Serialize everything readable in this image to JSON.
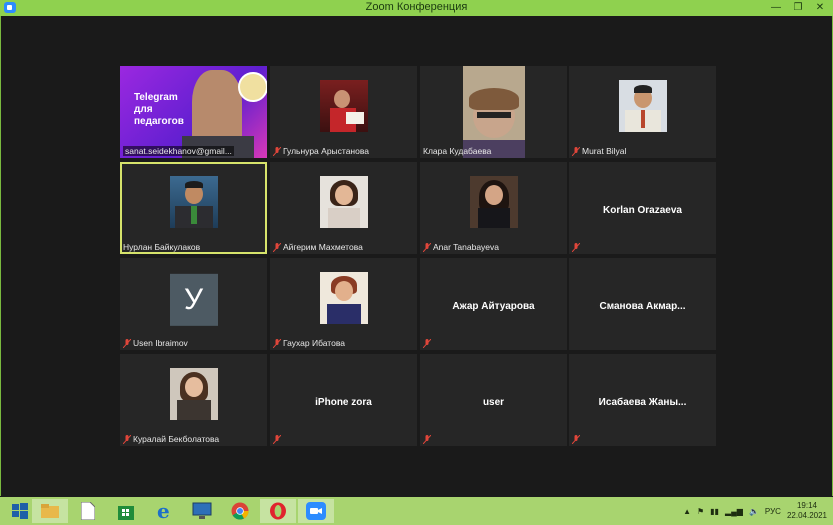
{
  "window": {
    "title": "Zoom Конференция",
    "min_glyph": "—",
    "max_glyph": "❐",
    "close_glyph": "✕"
  },
  "participants": [
    {
      "name": "sanat.seidekhanov@gmail...",
      "kind": "video-share",
      "share_text": "Telegram для педагогов",
      "muted": false
    },
    {
      "name": "Гульнура Арыстанова",
      "kind": "photo",
      "muted": true
    },
    {
      "name": "Клара Кудабаева",
      "kind": "video",
      "muted": false
    },
    {
      "name": "Murat Bilyal",
      "kind": "photo",
      "muted": true
    },
    {
      "name": "Нурлан Байкулаков",
      "kind": "photo",
      "muted": false,
      "active_speaker": true
    },
    {
      "name": "Айгерим Махметова",
      "kind": "photo",
      "muted": true
    },
    {
      "name": "Anar Tanabayeva",
      "kind": "photo",
      "muted": true
    },
    {
      "name": "Korlan Orazaeva",
      "kind": "name-only",
      "muted": true
    },
    {
      "name": "Usen Ibraimov",
      "kind": "avatar",
      "avatar_letter": "У",
      "muted": true
    },
    {
      "name": "Гаухар Ибатова",
      "kind": "photo",
      "muted": true
    },
    {
      "name": "Ажар Айтуарова",
      "kind": "name-only",
      "muted": true
    },
    {
      "name": "Сманова  Акмар...",
      "kind": "name-only",
      "muted": false
    },
    {
      "name": "Куралай Бекболатова",
      "kind": "photo",
      "muted": true
    },
    {
      "name": "iPhone zora",
      "kind": "name-only",
      "muted": true
    },
    {
      "name": "user",
      "kind": "name-only",
      "muted": true
    },
    {
      "name": "Исабаева  Жаны...",
      "kind": "name-only",
      "muted": true
    }
  ],
  "taskbar": {
    "apps": [
      "windows-start",
      "file-explorer",
      "file",
      "store",
      "internet-explorer",
      "remote-desktop",
      "chrome",
      "opera",
      "zoom"
    ],
    "tray_language": "РУС",
    "time": "19:14",
    "date": "22.04.2021"
  },
  "colors": {
    "titlebar": "#8fd14f",
    "taskbar": "#a8d46f",
    "active_outline": "#d6e36b",
    "tile": "#262626",
    "muted_icon": "#e0463a"
  }
}
